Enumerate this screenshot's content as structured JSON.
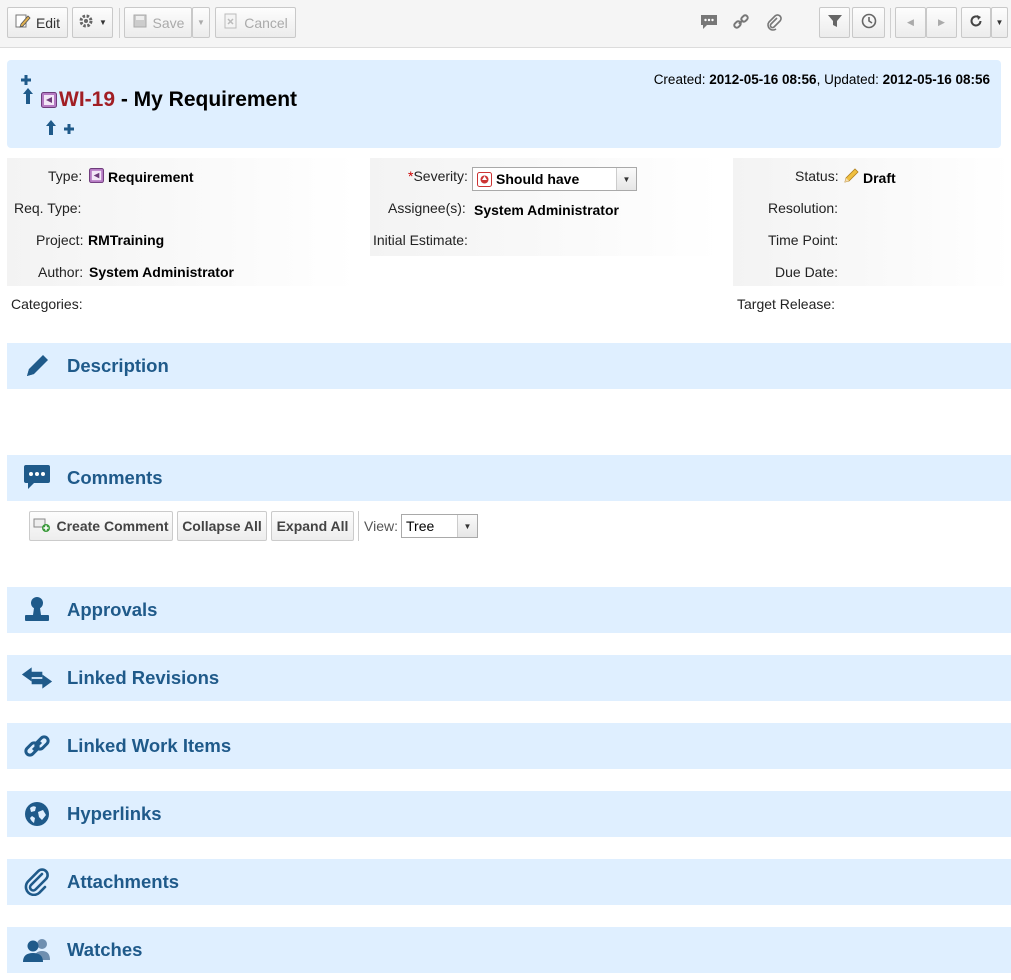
{
  "toolbar": {
    "edit_label": "Edit",
    "save_label": "Save",
    "cancel_label": "Cancel",
    "icons": [
      "edit-icon",
      "gear-icon",
      "save-icon",
      "cancel-icon",
      "comment-icon",
      "link-icon",
      "attachment-icon",
      "filter-icon",
      "history-icon",
      "prev-icon",
      "next-icon",
      "refresh-icon"
    ]
  },
  "header": {
    "id": "WI-19",
    "title": " - My Requirement",
    "created_label": "Created:",
    "created": "2012-05-16 08:56",
    "updated_label": "Updated:",
    "updated": "2012-05-16 08:56",
    "separator": ", "
  },
  "fields": {
    "type_label": "Type:",
    "type": "Requirement",
    "req_type_label": "Req. Type:",
    "project_label": "Project:",
    "project": "RMTraining",
    "author_label": "Author:",
    "author": "System Administrator",
    "categories_label": "Categories:",
    "severity_required_mark": "*",
    "severity_label": "Severity:",
    "severity": "Should have",
    "assignees_label": "Assignee(s):",
    "assignees": "System Administrator",
    "initial_estimate_label": "Initial Estimate:",
    "status_label": "Status:",
    "status": "Draft",
    "resolution_label": "Resolution:",
    "time_point_label": "Time Point:",
    "due_date_label": "Due Date:",
    "target_release_label": "Target Release:"
  },
  "sections": {
    "description": "Description",
    "comments": "Comments",
    "approvals": "Approvals",
    "linked_revisions": "Linked Revisions",
    "linked_work_items": "Linked Work Items",
    "hyperlinks": "Hyperlinks",
    "attachments": "Attachments",
    "watches": "Watches"
  },
  "comments_toolbar": {
    "create_comment": "Create Comment",
    "collapse_all": "Collapse All",
    "expand_all": "Expand All",
    "view_label": "View:",
    "view_value": "Tree"
  },
  "colors": {
    "section_bg": "#dfefff",
    "section_text": "#1f5a8a",
    "id_red": "#a11e24",
    "icon_blue": "#1f5a8a"
  }
}
